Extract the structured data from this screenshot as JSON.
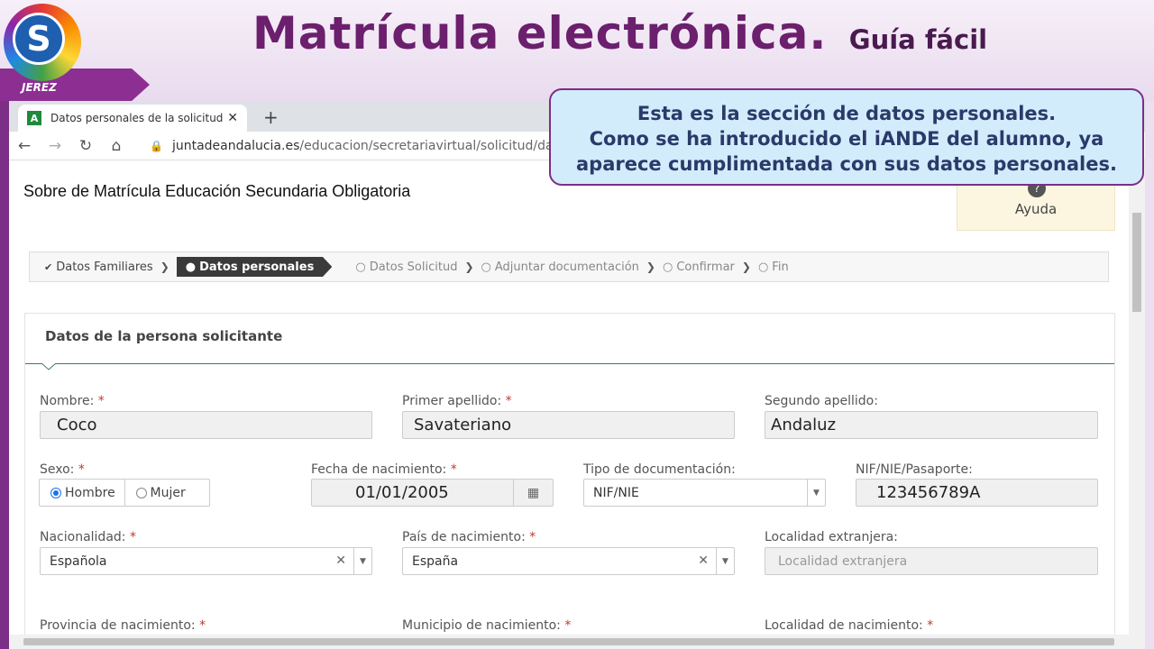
{
  "slide": {
    "title": "Matrícula electrónica.",
    "subtitle": "Guía fácil",
    "logo_letter": "S",
    "logo_city": "JEREZ"
  },
  "browser": {
    "tab_title": "Datos personales de la solicitud",
    "tab_favicon": "A",
    "url_host": "juntadeandalucia.es",
    "url_path": "/educacion/secretariavirtual/solicitud/dato"
  },
  "page": {
    "heading": "Sobre de Matrícula Educación Secundaria Obligatoria",
    "help_label": "Ayuda"
  },
  "steps": [
    {
      "label": "Datos Familiares"
    },
    {
      "label": "Datos personales"
    },
    {
      "label": "Datos Solicitud"
    },
    {
      "label": "Adjuntar documentación"
    },
    {
      "label": "Confirmar"
    },
    {
      "label": "Fin"
    }
  ],
  "form": {
    "section_title": "Datos de la persona solicitante",
    "nombre": {
      "label": "Nombre:",
      "value": "Coco"
    },
    "primer_apellido": {
      "label": "Primer apellido:",
      "value": "Savateriano"
    },
    "segundo_apellido": {
      "label": "Segundo apellido:",
      "value": "Andaluz"
    },
    "sexo": {
      "label": "Sexo:",
      "options": [
        "Hombre",
        "Mujer"
      ]
    },
    "fecha": {
      "label": "Fecha de nacimiento:",
      "value": "01/01/2005"
    },
    "tipo_doc": {
      "label": "Tipo de documentación:",
      "value": "NIF/NIE"
    },
    "nif": {
      "label": "NIF/NIE/Pasaporte:",
      "value": "123456789A"
    },
    "nacionalidad": {
      "label": "Nacionalidad:",
      "value": "Española"
    },
    "pais": {
      "label": "País de nacimiento:",
      "value": "España"
    },
    "localidad_ext": {
      "label": "Localidad extranjera:",
      "placeholder": "Localidad extranjera"
    },
    "provincia": {
      "label": "Provincia de nacimiento:"
    },
    "municipio": {
      "label": "Municipio de nacimiento:"
    },
    "localidad": {
      "label": "Localidad de nacimiento:"
    },
    "required_mark": "*"
  },
  "callout": {
    "line1": "Esta es la sección de datos personales.",
    "line2": "Como se ha introducido el iANDE del alumno, ya",
    "line3": "aparece cumplimentada con sus datos personales."
  }
}
